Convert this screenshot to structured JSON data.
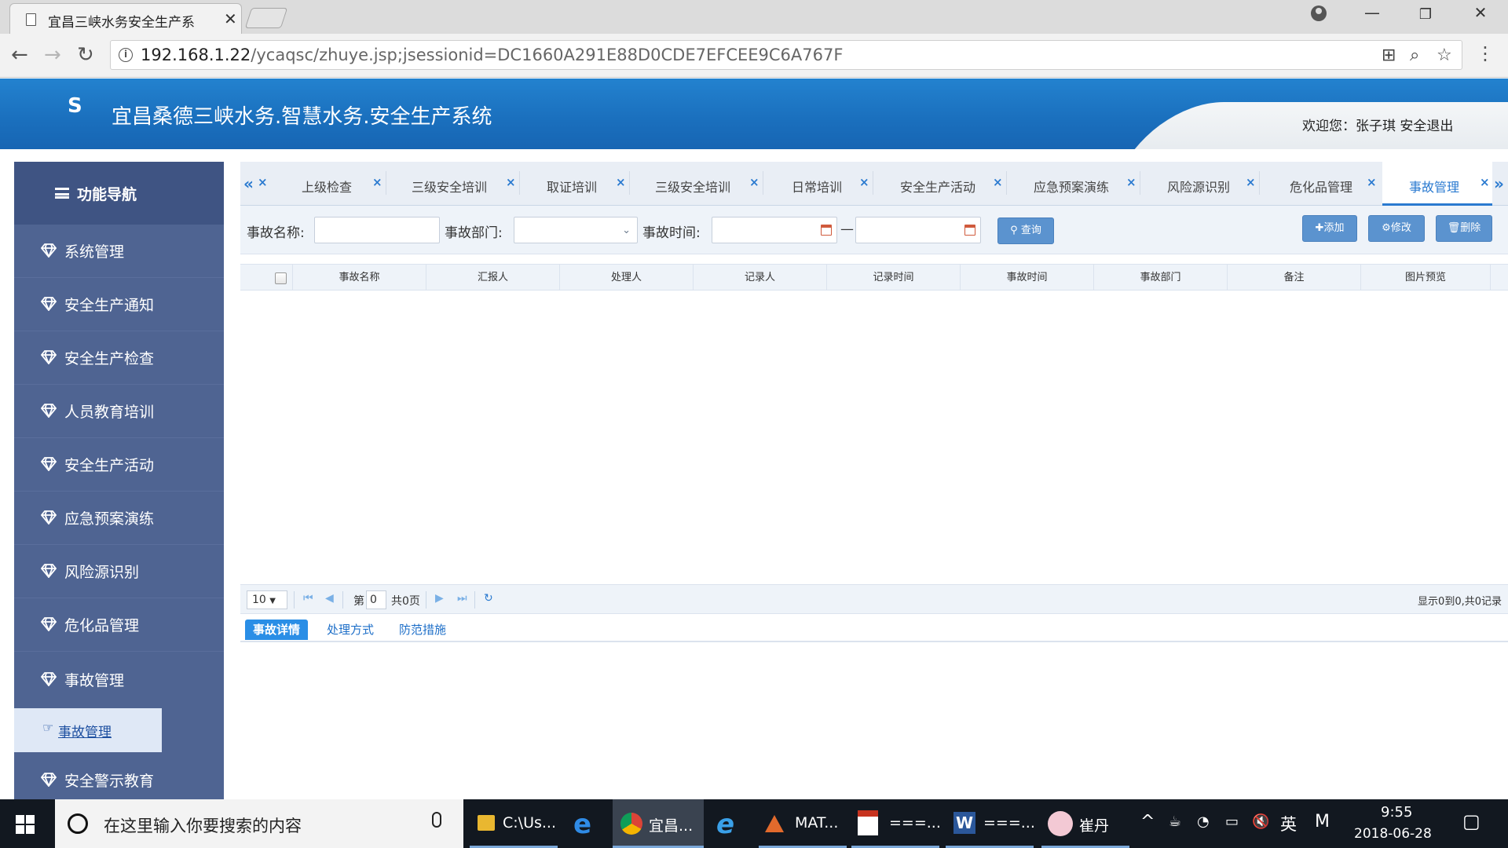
{
  "browser": {
    "tab_title": "宜昌三峡水务安全生产系",
    "url_host": "192.168.1.22",
    "url_path": "/ycaqsc/zhuye.jsp;jsessionid=DC1660A291E88D0CDE7EFCEE9C6A767F"
  },
  "app": {
    "title": "宜昌桑德三峡水务.智慧水务.安全生产系统",
    "welcome": "欢迎您：张子琪 安全退出"
  },
  "sidebar": {
    "header": "功能导航",
    "items": [
      {
        "label": "系统管理"
      },
      {
        "label": "安全生产通知"
      },
      {
        "label": "安全生产检查"
      },
      {
        "label": "人员教育培训"
      },
      {
        "label": "安全生产活动"
      },
      {
        "label": "应急预案演练"
      },
      {
        "label": "风险源识别"
      },
      {
        "label": "危化品管理"
      },
      {
        "label": "事故管理"
      },
      {
        "label": "安全警示教育"
      }
    ],
    "active_sub": "事故管理"
  },
  "tabs": [
    {
      "label": "上级检查"
    },
    {
      "label": "三级安全培训"
    },
    {
      "label": "取证培训"
    },
    {
      "label": "三级安全培训"
    },
    {
      "label": "日常培训"
    },
    {
      "label": "安全生产活动"
    },
    {
      "label": "应急预案演练"
    },
    {
      "label": "风险源识别"
    },
    {
      "label": "危化品管理"
    },
    {
      "label": "事故管理"
    }
  ],
  "filters": {
    "name_label": "事故名称:",
    "dept_label": "事故部门:",
    "time_label": "事故时间:",
    "range_sep": "—",
    "name_value": "",
    "dept_value": "",
    "time_from": "",
    "time_to": "",
    "query_label": "查询",
    "add_label": "添加",
    "edit_label": "修改",
    "delete_label": "删除"
  },
  "grid": {
    "columns": [
      "事故名称",
      "汇报人",
      "处理人",
      "记录人",
      "记录时间",
      "事故时间",
      "事故部门",
      "备注",
      "图片预览"
    ],
    "rows": []
  },
  "pager": {
    "page_size": "10",
    "page_prefix": "第",
    "page_no": "0",
    "page_total": "共0页",
    "summary": "显示0到0,共0记录"
  },
  "detail_tabs": [
    {
      "label": "事故详情"
    },
    {
      "label": "处理方式"
    },
    {
      "label": "防范措施"
    }
  ],
  "taskbar": {
    "search_placeholder": "在这里输入你要搜索的内容",
    "items": [
      {
        "label": "C:\\Us..."
      },
      {
        "label": "宜昌..."
      },
      {
        "label": "MAT..."
      },
      {
        "label": "===..."
      },
      {
        "label": "===..."
      },
      {
        "label": "崔丹"
      }
    ],
    "ime": "英",
    "time": "9:55",
    "date": "2018-06-28"
  }
}
